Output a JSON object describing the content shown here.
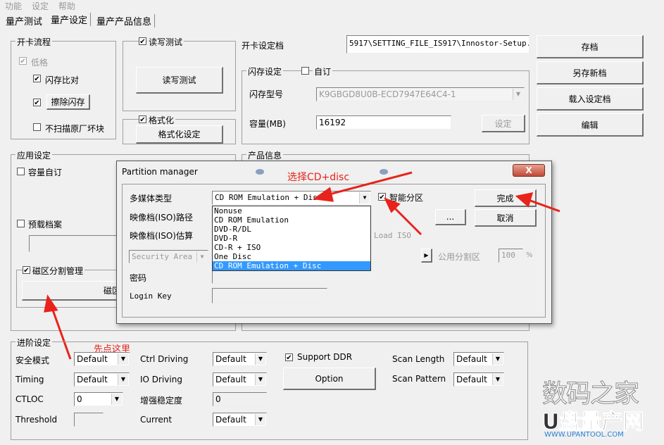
{
  "menu": [
    "功能",
    "设定",
    "帮助"
  ],
  "tabs": [
    {
      "label": "量产测试"
    },
    {
      "label": "量产设定",
      "selected": true
    },
    {
      "label": "量产产品信息"
    }
  ],
  "card_flow": {
    "title": "开卡流程",
    "low_format": "低格",
    "flash_compare": "闪存比对",
    "erase_flash": "擦除闪存",
    "no_scan_bad": "不扫描原厂坏块"
  },
  "rw_test": {
    "title": "读写测试",
    "button": "读写测试"
  },
  "format": {
    "title": "格式化",
    "button": "格式化设定"
  },
  "setting_file": {
    "label": "开卡设定档",
    "value": "5917\\SETTING_FILE_IS917\\Innostor-Setup.ini"
  },
  "side_buttons": [
    "存档",
    "另存新档",
    "载入设定档",
    "编辑"
  ],
  "flash": {
    "title": "闪存设定",
    "custom": "自订",
    "model_label": "闪存型号",
    "model_value": "K9GBGD8U0B-ECD7947E64C4-1",
    "capacity_label": "容量(MB)",
    "capacity_value": "16192",
    "set_button": "设定"
  },
  "app": {
    "title": "应用设定",
    "capacity_custom": "容量自订",
    "preload": "预载档案",
    "partition_mgmt": "磁区分割管理",
    "partition_button": "磁区"
  },
  "product": {
    "title": "产品信息"
  },
  "dialog": {
    "title": "Partition manager",
    "close": "X",
    "media_label": "多媒体类型",
    "media_value": "CD ROM Emulation + Disc",
    "smart_partition": "智能分区",
    "done": "完成",
    "cancel": "取消",
    "browse": "...",
    "iso_path": "映像档(ISO)路径",
    "iso_estimate": "映像档(ISO)估算",
    "load_iso": "Load ISO",
    "security_area": "Security Area",
    "public_partition": "公用分割区",
    "public_value": "100",
    "percent": "%",
    "password": "密码",
    "login_key": "Login Key",
    "options": [
      "Nonuse",
      "CD ROM Emulation",
      "DVD-R/DL",
      "DVD-R",
      "CD-R + ISO",
      "One Disc",
      "CD ROM Emulation + Disc"
    ],
    "selected_index": 6
  },
  "advanced": {
    "title": "进阶设定",
    "rows": [
      {
        "l1": "安全模式",
        "v1": "Default",
        "l2": "Ctrl Driving",
        "v2": "Default"
      },
      {
        "l1": "Timing",
        "v1": "Default",
        "l2": "IO Driving",
        "v2": "Default"
      },
      {
        "l1": "CTLOC",
        "v1": "0",
        "l2": "增强稳定度",
        "v2": "0"
      },
      {
        "l1": "Threshold",
        "v1": "",
        "l2": "Current",
        "v2": "Default"
      }
    ],
    "support_ddr": "Support DDR",
    "option": "Option",
    "scan_length": "Scan Length",
    "scan_length_value": "Default",
    "scan_pattern": "Scan Pattern",
    "scan_pattern_value": "Default"
  },
  "annotations": {
    "select_hint": "选择CD+disc",
    "click_first": "先点这里"
  },
  "watermark": {
    "line1": "数码之家",
    "line2": "U盘量产网",
    "url": "WWW.UPANTOOL.COM"
  },
  "colors": {
    "selection": "#3399ff",
    "annotation": "#e8231b"
  }
}
